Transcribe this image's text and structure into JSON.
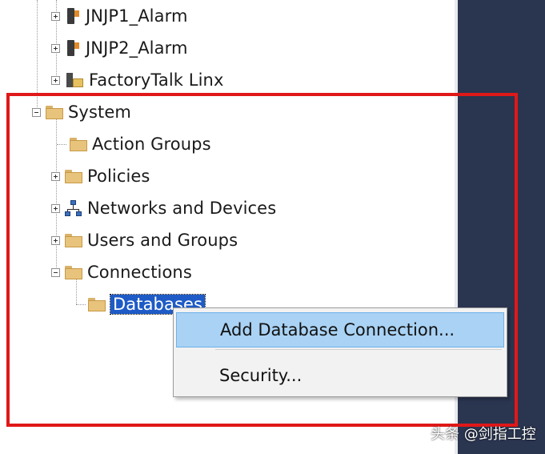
{
  "tree": {
    "nodes": [
      {
        "label": "JNJP1_Alarm",
        "icon": "server-icon"
      },
      {
        "label": "JNJP2_Alarm",
        "icon": "server-icon"
      },
      {
        "label": "FactoryTalk Linx",
        "icon": "linx-icon"
      },
      {
        "label": "System",
        "icon": "folder-icon"
      },
      {
        "label": "Action Groups",
        "icon": "folder-icon"
      },
      {
        "label": "Policies",
        "icon": "folder-icon"
      },
      {
        "label": "Networks and Devices",
        "icon": "network-icon"
      },
      {
        "label": "Users and Groups",
        "icon": "folder-icon"
      },
      {
        "label": "Connections",
        "icon": "folder-icon"
      },
      {
        "label": "Databases",
        "icon": "folder-icon"
      }
    ]
  },
  "context_menu": {
    "items": [
      {
        "label": "Add Database Connection..."
      },
      {
        "label": "Security..."
      }
    ]
  },
  "watermark": {
    "text": "头条 @剑指工控"
  },
  "colors": {
    "selection": "#1e5bc6",
    "highlight_frame": "#e01818",
    "menu_hover": "#a9d2f4",
    "side_panel": "#2a3550"
  }
}
